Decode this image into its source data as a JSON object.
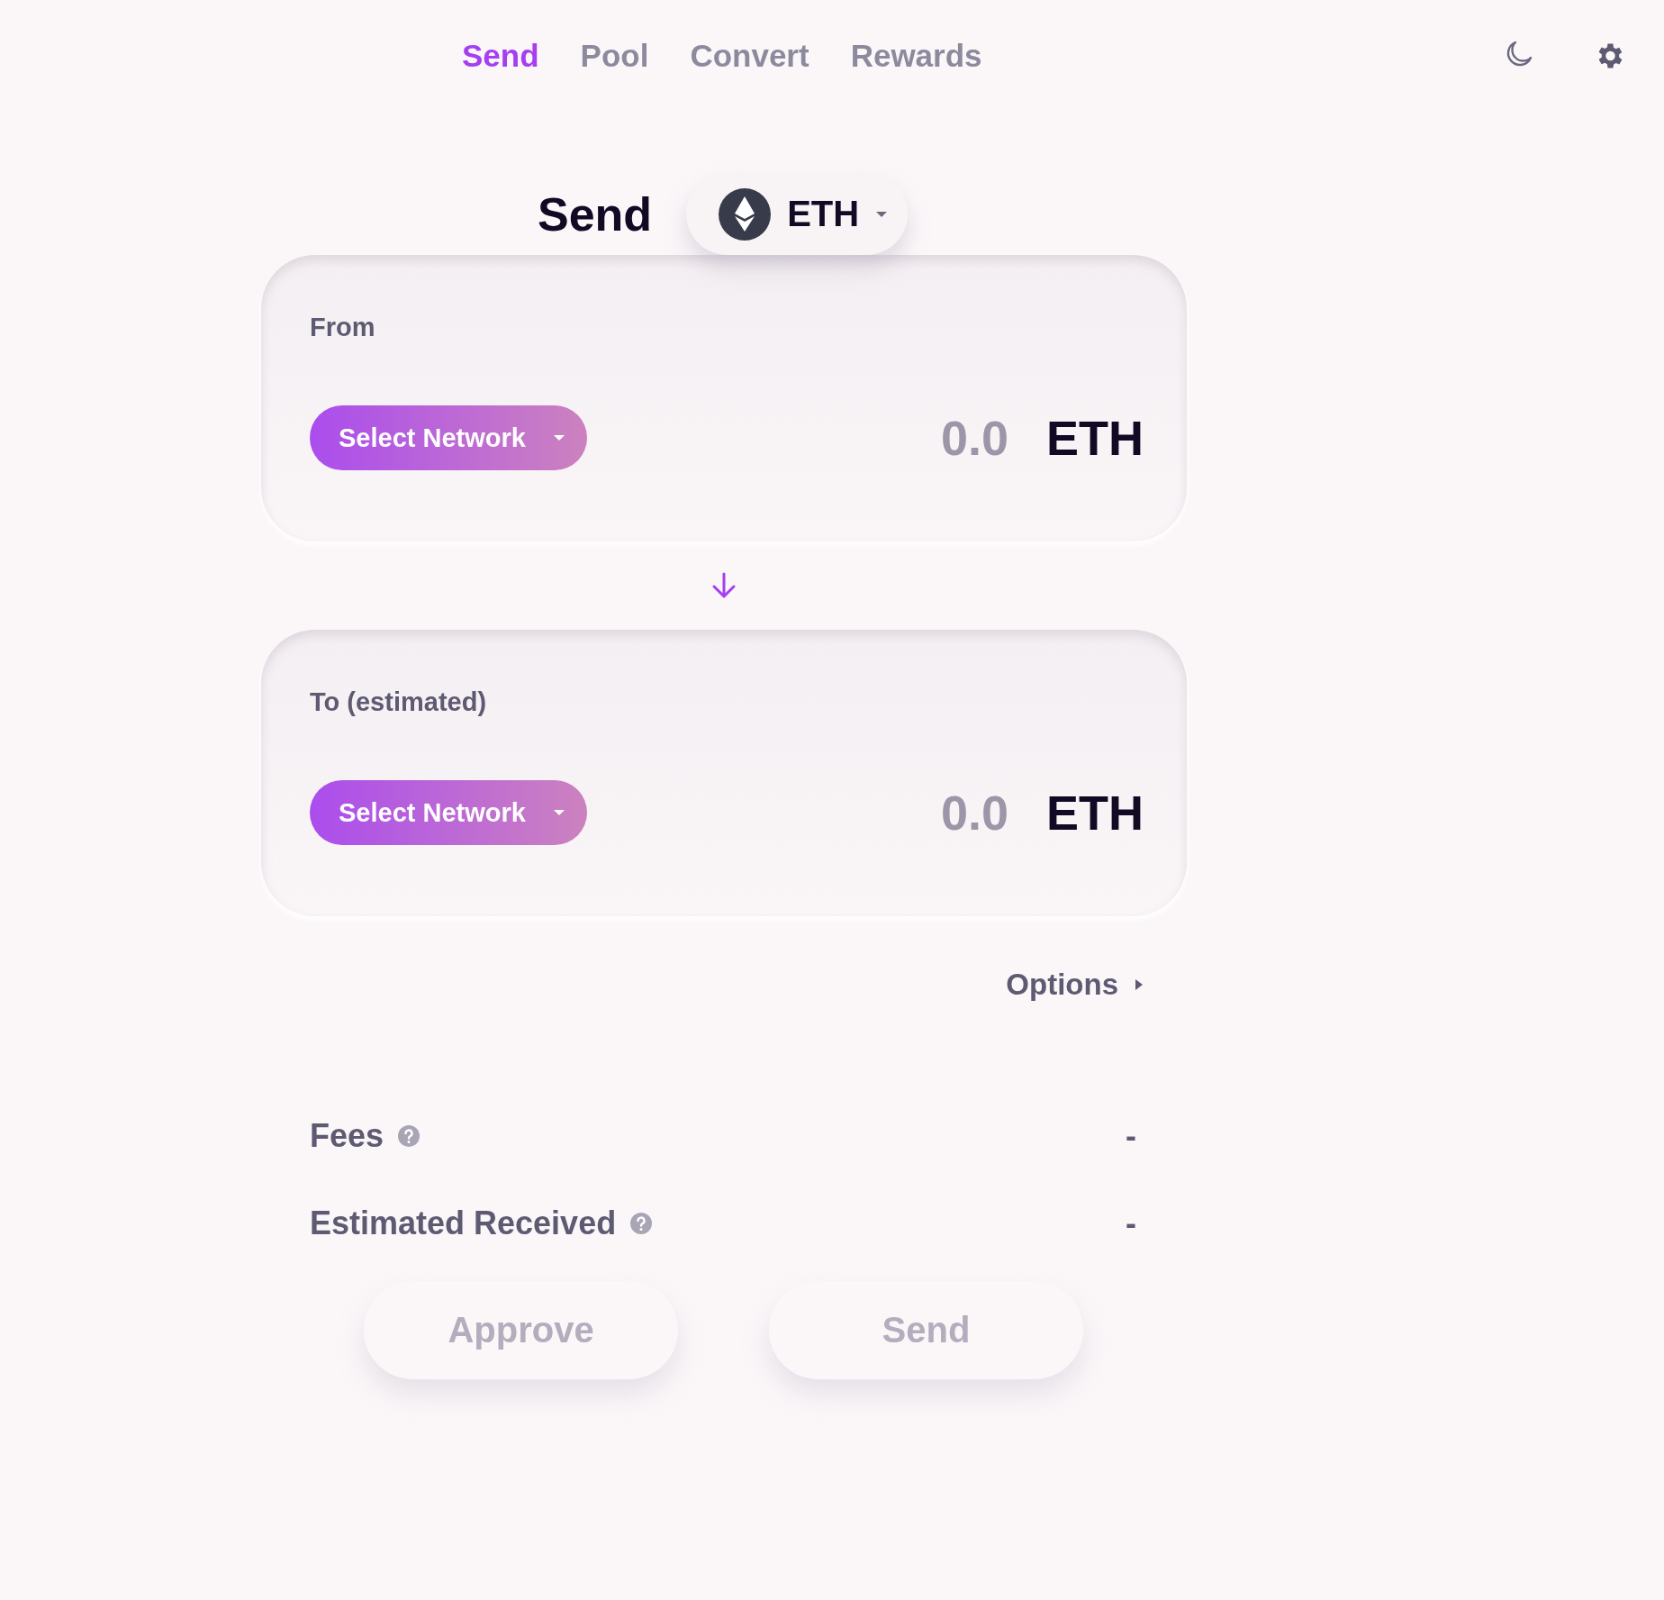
{
  "nav": {
    "tabs": [
      {
        "label": "Send",
        "selected": true
      },
      {
        "label": "Pool",
        "selected": false
      },
      {
        "label": "Convert",
        "selected": false
      },
      {
        "label": "Rewards",
        "selected": false
      }
    ]
  },
  "header": {
    "title": "Send",
    "token": "ETH"
  },
  "cards": [
    {
      "label": "From",
      "network_button": "Select Network",
      "amount": "0.0",
      "token": "ETH"
    },
    {
      "label": "To (estimated)",
      "network_button": "Select Network",
      "amount": "0.0",
      "token": "ETH"
    }
  ],
  "options": {
    "label": "Options",
    "expanded": false
  },
  "details": [
    {
      "label": "Fees",
      "value": "-"
    },
    {
      "label": "Estimated Received",
      "value": "-"
    }
  ],
  "buttons": [
    {
      "label": "Approve",
      "disabled": true
    },
    {
      "label": "Send",
      "disabled": true
    }
  ]
}
